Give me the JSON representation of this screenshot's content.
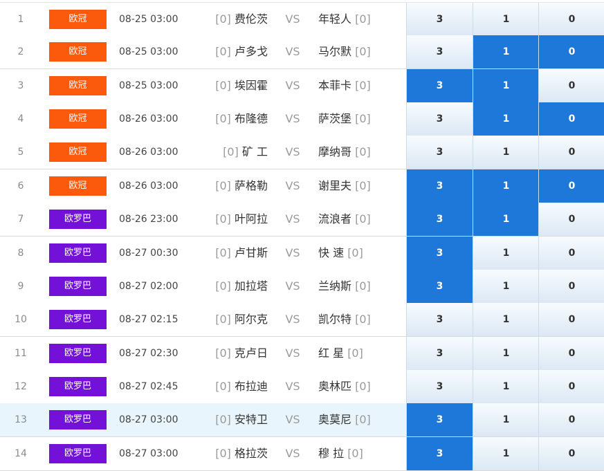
{
  "colors": {
    "league_ucl": "#fb5a0c",
    "league_uel": "#7411d8",
    "selected": "#1d78d9"
  },
  "rows": [
    {
      "num": "1",
      "league": "欧冠",
      "league_color": "#fb5a0c",
      "time": "08-25 03:00",
      "home_rank": "[0]",
      "home": "费伦茨",
      "vs": "VS",
      "away": "年轻人",
      "away_rank": "[0]",
      "odds": [
        "3",
        "1",
        "0"
      ],
      "selected": [
        false,
        false,
        false
      ],
      "highlighted": false
    },
    {
      "num": "2",
      "league": "欧冠",
      "league_color": "#fb5a0c",
      "time": "08-25 03:00",
      "home_rank": "[0]",
      "home": "卢多戈",
      "vs": "VS",
      "away": "马尔默",
      "away_rank": "[0]",
      "odds": [
        "3",
        "1",
        "0"
      ],
      "selected": [
        false,
        true,
        true
      ],
      "highlighted": false
    },
    {
      "num": "3",
      "league": "欧冠",
      "league_color": "#fb5a0c",
      "time": "08-25 03:00",
      "home_rank": "[0]",
      "home": "埃因霍",
      "vs": "VS",
      "away": "本菲卡",
      "away_rank": "[0]",
      "odds": [
        "3",
        "1",
        "0"
      ],
      "selected": [
        true,
        true,
        false
      ],
      "highlighted": false
    },
    {
      "num": "4",
      "league": "欧冠",
      "league_color": "#fb5a0c",
      "time": "08-26 03:00",
      "home_rank": "[0]",
      "home": "布隆德",
      "vs": "VS",
      "away": "萨茨堡",
      "away_rank": "[0]",
      "odds": [
        "3",
        "1",
        "0"
      ],
      "selected": [
        false,
        true,
        true
      ],
      "highlighted": false
    },
    {
      "num": "5",
      "league": "欧冠",
      "league_color": "#fb5a0c",
      "time": "08-26 03:00",
      "home_rank": "[0]",
      "home": "矿 工",
      "vs": "VS",
      "away": "摩纳哥",
      "away_rank": "[0]",
      "odds": [
        "3",
        "1",
        "0"
      ],
      "selected": [
        false,
        false,
        false
      ],
      "highlighted": false
    },
    {
      "num": "6",
      "league": "欧冠",
      "league_color": "#fb5a0c",
      "time": "08-26 03:00",
      "home_rank": "[0]",
      "home": "萨格勒",
      "vs": "VS",
      "away": "谢里夫",
      "away_rank": "[0]",
      "odds": [
        "3",
        "1",
        "0"
      ],
      "selected": [
        true,
        true,
        true
      ],
      "highlighted": false
    },
    {
      "num": "7",
      "league": "欧罗巴",
      "league_color": "#7411d8",
      "time": "08-26 23:00",
      "home_rank": "[0]",
      "home": "叶阿拉",
      "vs": "VS",
      "away": "流浪者",
      "away_rank": "[0]",
      "odds": [
        "3",
        "1",
        "0"
      ],
      "selected": [
        true,
        true,
        false
      ],
      "highlighted": false
    },
    {
      "num": "8",
      "league": "欧罗巴",
      "league_color": "#7411d8",
      "time": "08-27 00:30",
      "home_rank": "[0]",
      "home": "卢甘斯",
      "vs": "VS",
      "away": "快 速",
      "away_rank": "[0]",
      "odds": [
        "3",
        "1",
        "0"
      ],
      "selected": [
        true,
        false,
        false
      ],
      "highlighted": false
    },
    {
      "num": "9",
      "league": "欧罗巴",
      "league_color": "#7411d8",
      "time": "08-27 02:00",
      "home_rank": "[0]",
      "home": "加拉塔",
      "vs": "VS",
      "away": "兰纳斯",
      "away_rank": "[0]",
      "odds": [
        "3",
        "1",
        "0"
      ],
      "selected": [
        true,
        false,
        false
      ],
      "highlighted": false
    },
    {
      "num": "10",
      "league": "欧罗巴",
      "league_color": "#7411d8",
      "time": "08-27 02:15",
      "home_rank": "[0]",
      "home": "阿尔克",
      "vs": "VS",
      "away": "凯尔特",
      "away_rank": "[0]",
      "odds": [
        "3",
        "1",
        "0"
      ],
      "selected": [
        false,
        false,
        false
      ],
      "highlighted": false
    },
    {
      "num": "11",
      "league": "欧罗巴",
      "league_color": "#7411d8",
      "time": "08-27 02:30",
      "home_rank": "[0]",
      "home": "克卢日",
      "vs": "VS",
      "away": "红 星",
      "away_rank": "[0]",
      "odds": [
        "3",
        "1",
        "0"
      ],
      "selected": [
        false,
        false,
        false
      ],
      "highlighted": false
    },
    {
      "num": "12",
      "league": "欧罗巴",
      "league_color": "#7411d8",
      "time": "08-27 02:45",
      "home_rank": "[0]",
      "home": "布拉迪",
      "vs": "VS",
      "away": "奥林匹",
      "away_rank": "[0]",
      "odds": [
        "3",
        "1",
        "0"
      ],
      "selected": [
        false,
        false,
        false
      ],
      "highlighted": false
    },
    {
      "num": "13",
      "league": "欧罗巴",
      "league_color": "#7411d8",
      "time": "08-27 03:00",
      "home_rank": "[0]",
      "home": "安特卫",
      "vs": "VS",
      "away": "奥莫尼",
      "away_rank": "[0]",
      "odds": [
        "3",
        "1",
        "0"
      ],
      "selected": [
        true,
        false,
        false
      ],
      "highlighted": true
    },
    {
      "num": "14",
      "league": "欧罗巴",
      "league_color": "#7411d8",
      "time": "08-27 03:00",
      "home_rank": "[0]",
      "home": "格拉茨",
      "vs": "VS",
      "away": "穆 拉",
      "away_rank": "[0]",
      "odds": [
        "3",
        "1",
        "0"
      ],
      "selected": [
        true,
        false,
        false
      ],
      "highlighted": false
    }
  ]
}
